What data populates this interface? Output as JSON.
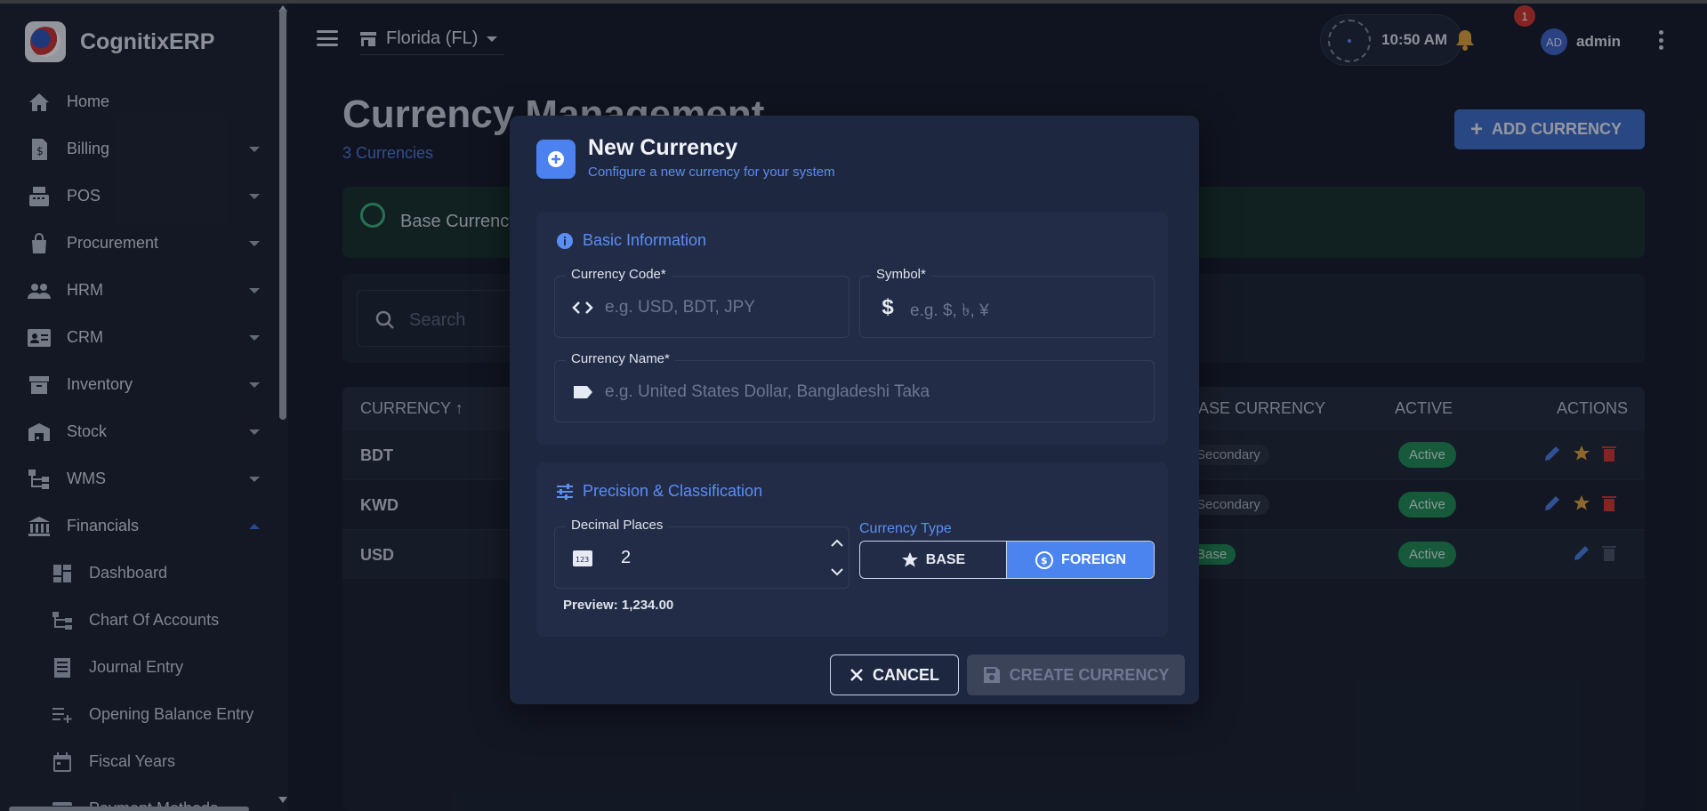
{
  "app": {
    "name": "CognitixERP"
  },
  "sidebar": {
    "items": [
      {
        "label": "Home",
        "icon": "home-icon"
      },
      {
        "label": "Billing",
        "icon": "receipt-icon",
        "expandable": true
      },
      {
        "label": "POS",
        "icon": "cash-register-icon",
        "expandable": true
      },
      {
        "label": "Procurement",
        "icon": "shopping-bag-icon",
        "expandable": true
      },
      {
        "label": "HRM",
        "icon": "people-icon",
        "expandable": true
      },
      {
        "label": "CRM",
        "icon": "contact-card-icon",
        "expandable": true
      },
      {
        "label": "Inventory",
        "icon": "archive-icon",
        "expandable": true
      },
      {
        "label": "Stock",
        "icon": "warehouse-icon",
        "expandable": true
      },
      {
        "label": "WMS",
        "icon": "hierarchy-icon",
        "expandable": true
      },
      {
        "label": "Financials",
        "icon": "bank-icon",
        "expandable": true,
        "expanded": true
      }
    ],
    "subitems": [
      {
        "label": "Dashboard",
        "icon": "dashboard-icon"
      },
      {
        "label": "Chart Of Accounts",
        "icon": "tree-icon"
      },
      {
        "label": "Journal Entry",
        "icon": "journal-icon"
      },
      {
        "label": "Opening Balance Entry",
        "icon": "list-add-icon"
      },
      {
        "label": "Fiscal Years",
        "icon": "calendar-icon"
      },
      {
        "label": "Payment Methods",
        "icon": "card-icon"
      }
    ]
  },
  "header": {
    "branch": "Florida (FL)",
    "time": "10:50 AM",
    "notifications": "1",
    "avatar_initials": "AD",
    "username": "admin"
  },
  "main": {
    "title": "Currency Management",
    "count": "3 Currencies",
    "add_button": "ADD CURRENCY",
    "alert": "Base Currency",
    "search_placeholder": "Search",
    "columns": {
      "currency": "CURRENCY",
      "base": "BASE CURRENCY",
      "active": "ACTIVE",
      "actions": "ACTIONS"
    },
    "rows": [
      {
        "code": "BDT",
        "type": "Secondary",
        "active": "Active"
      },
      {
        "code": "KWD",
        "type": "Secondary",
        "active": "Active"
      },
      {
        "code": "USD",
        "type": "Base",
        "active": "Active"
      }
    ]
  },
  "dialog": {
    "title": "New Currency",
    "subtitle": "Configure a new currency for your system",
    "basic": {
      "title": "Basic Information",
      "code_label": "Currency Code*",
      "code_placeholder": "e.g. USD, BDT, JPY",
      "symbol_label": "Symbol*",
      "symbol_placeholder": "e.g. $, ৳, ¥",
      "name_label": "Currency Name*",
      "name_placeholder": "e.g. United States Dollar, Bangladeshi Taka"
    },
    "precision": {
      "title": "Precision & Classification",
      "decimal_label": "Decimal Places",
      "decimal_value": "2",
      "preview": "Preview: 1,234.00",
      "type_label": "Currency Type",
      "base": "BASE",
      "foreign": "FOREIGN",
      "selected": "FOREIGN"
    },
    "cancel": "CANCEL",
    "create": "CREATE CURRENCY"
  },
  "colors": {
    "accent": "#4b84ee",
    "success": "#1f8a55",
    "danger": "#d0362f",
    "warning": "#e0a13a"
  }
}
